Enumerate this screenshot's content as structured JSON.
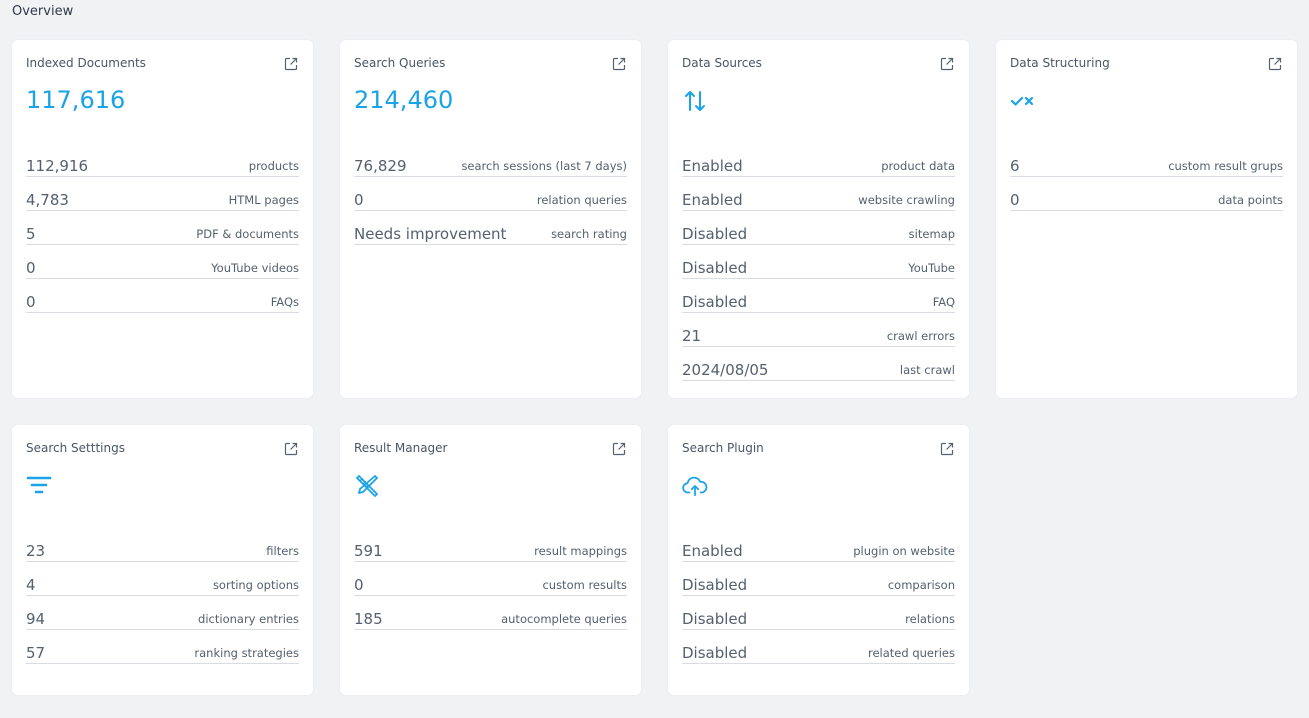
{
  "page": {
    "title": "Overview"
  },
  "colors": {
    "accent": "#1aa3e6",
    "text": "#55606f",
    "background": "#f1f2f4"
  },
  "cards": [
    {
      "title": "Indexed Documents",
      "big": "117,616",
      "rows": [
        {
          "value": "112,916",
          "label": "products"
        },
        {
          "value": "4,783",
          "label": "HTML pages"
        },
        {
          "value": "5",
          "label": "PDF & documents"
        },
        {
          "value": "0",
          "label": "YouTube videos"
        },
        {
          "value": "0",
          "label": "FAQs"
        }
      ]
    },
    {
      "title": "Search Queries",
      "big": "214,460",
      "rows": [
        {
          "value": "76,829",
          "label": "search sessions (last 7 days)"
        },
        {
          "value": "0",
          "label": "relation queries"
        },
        {
          "value": "Needs improvement",
          "label": "search rating"
        }
      ]
    },
    {
      "title": "Data Sources",
      "icon": "up-down-arrows-icon",
      "rows": [
        {
          "value": "Enabled",
          "label": "product data"
        },
        {
          "value": "Enabled",
          "label": "website crawling"
        },
        {
          "value": "Disabled",
          "label": "sitemap"
        },
        {
          "value": "Disabled",
          "label": "YouTube"
        },
        {
          "value": "Disabled",
          "label": "FAQ"
        },
        {
          "value": "21",
          "label": "crawl errors"
        },
        {
          "value": "2024/08/05",
          "label": "last crawl"
        }
      ]
    },
    {
      "title": "Data Structuring",
      "icon": "check-cross-icon",
      "rows": [
        {
          "value": "6",
          "label": "custom result grups"
        },
        {
          "value": "0",
          "label": "data points"
        }
      ]
    },
    {
      "title": "Search Setttings",
      "icon": "filter-lines-icon",
      "rows": [
        {
          "value": "23",
          "label": "filters"
        },
        {
          "value": "4",
          "label": "sorting options"
        },
        {
          "value": "94",
          "label": "dictionary entries"
        },
        {
          "value": "57",
          "label": "ranking strategies"
        }
      ]
    },
    {
      "title": "Result Manager",
      "icon": "tools-icon",
      "rows": [
        {
          "value": "591",
          "label": "result mappings"
        },
        {
          "value": "0",
          "label": "custom results"
        },
        {
          "value": "185",
          "label": "autocomplete queries"
        }
      ]
    },
    {
      "title": "Search Plugin",
      "icon": "cloud-upload-icon",
      "rows": [
        {
          "value": "Enabled",
          "label": "plugin on website"
        },
        {
          "value": "Disabled",
          "label": "comparison"
        },
        {
          "value": "Disabled",
          "label": "relations"
        },
        {
          "value": "Disabled",
          "label": "related queries"
        }
      ]
    }
  ]
}
